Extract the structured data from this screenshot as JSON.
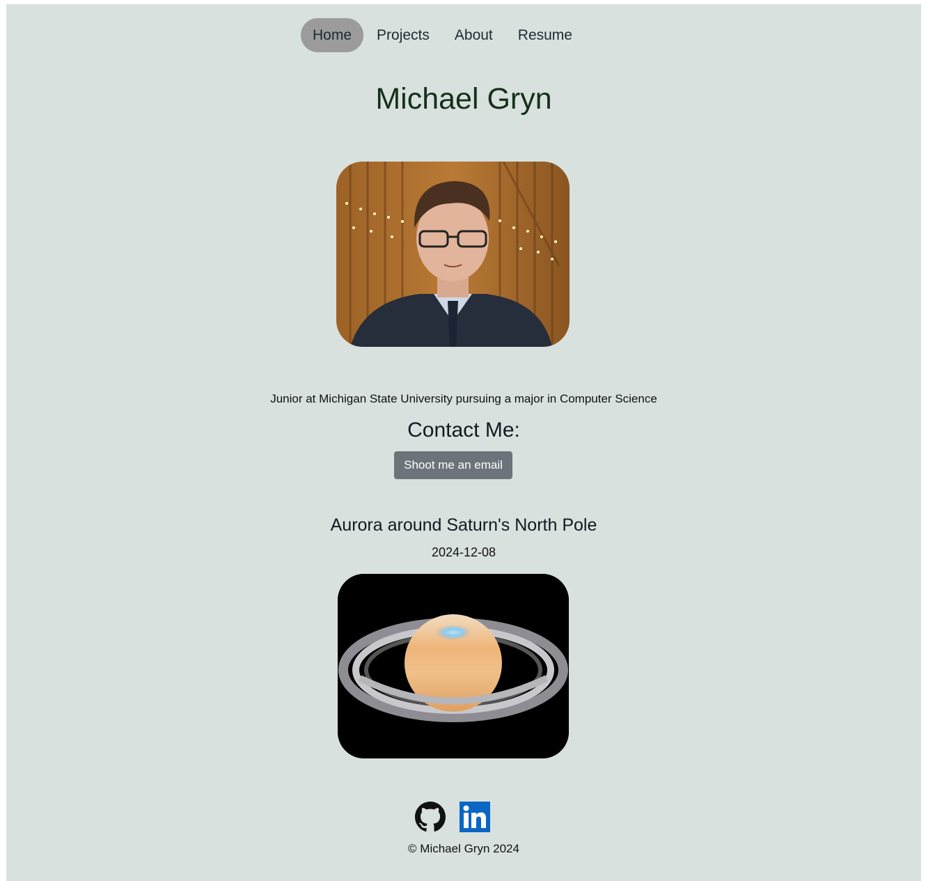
{
  "nav": {
    "items": [
      {
        "label": "Home",
        "active": true
      },
      {
        "label": "Projects"
      },
      {
        "label": "About"
      },
      {
        "label": "Resume"
      }
    ]
  },
  "header": {
    "title": "Michael Gryn"
  },
  "profile": {
    "tagline": "Junior at Michigan State University pursuing a major in Computer Science"
  },
  "contact": {
    "heading": "Contact Me:",
    "button_label": "Shoot me an email"
  },
  "apod": {
    "title": "Aurora around Saturn's North Pole",
    "date": "2024-12-08"
  },
  "footer": {
    "socials": [
      {
        "icon": "github-icon"
      },
      {
        "icon": "linkedin-icon",
        "color": "#0a66c2"
      }
    ],
    "copyright": "© Michael Gryn 2024"
  },
  "colors": {
    "background": "#d8e1de",
    "nav_active": "#9b9b9b",
    "button": "#6c737b",
    "title": "#143019"
  }
}
